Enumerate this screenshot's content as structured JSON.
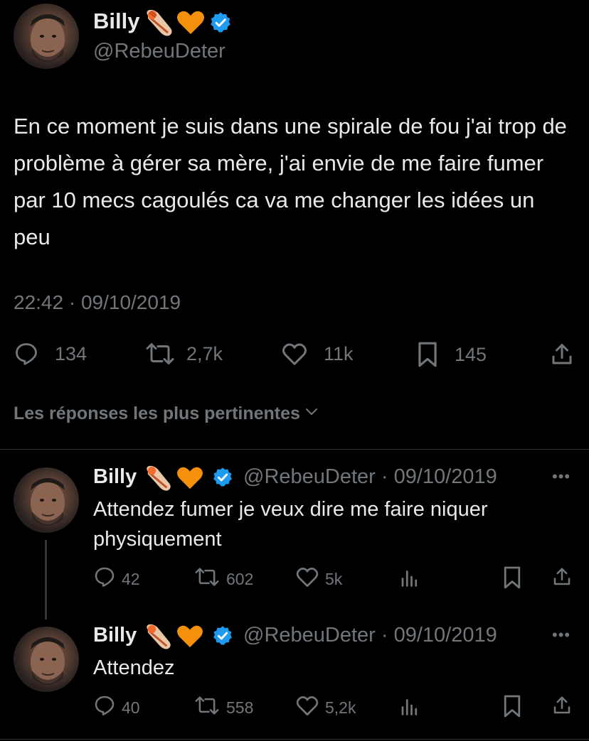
{
  "tweet": {
    "author_name": "Billy",
    "author_handle": "@RebeuDeter",
    "text": "En ce moment je suis dans une spirale de fou j'ai trop de problème à gérer sa mère, j'ai envie de me faire fumer par 10 mecs cagoulés ca va me changer les idées un peu",
    "timestamp": "22:42 · 09/10/2019",
    "stats": {
      "replies": "134",
      "retweets": "2,7k",
      "likes": "11k",
      "bookmarks": "145"
    }
  },
  "replies_sort_label": "Les réponses les plus pertinentes",
  "replies": [
    {
      "author_name": "Billy",
      "meta": "@RebeuDeter · 09/10/2019",
      "text": "Attendez fumer je veux dire me faire niquer physiquement",
      "stats": {
        "replies": "42",
        "retweets": "602",
        "likes": "5k"
      }
    },
    {
      "author_name": "Billy",
      "meta": "@RebeuDeter · 09/10/2019",
      "text": "Attendez",
      "stats": {
        "replies": "40",
        "retweets": "558",
        "likes": "5,2k"
      }
    }
  ],
  "icons": {
    "badge_1": "baseball-glove-emoji",
    "badge_2": "orange-heart-emoji",
    "verified": "verified-badge-icon",
    "more": "more-dots-icon"
  },
  "colors": {
    "background": "#000000",
    "text": "#e7e9ea",
    "muted": "#71767b",
    "verified": "#1d9bf0",
    "heart": "#f4900c"
  }
}
